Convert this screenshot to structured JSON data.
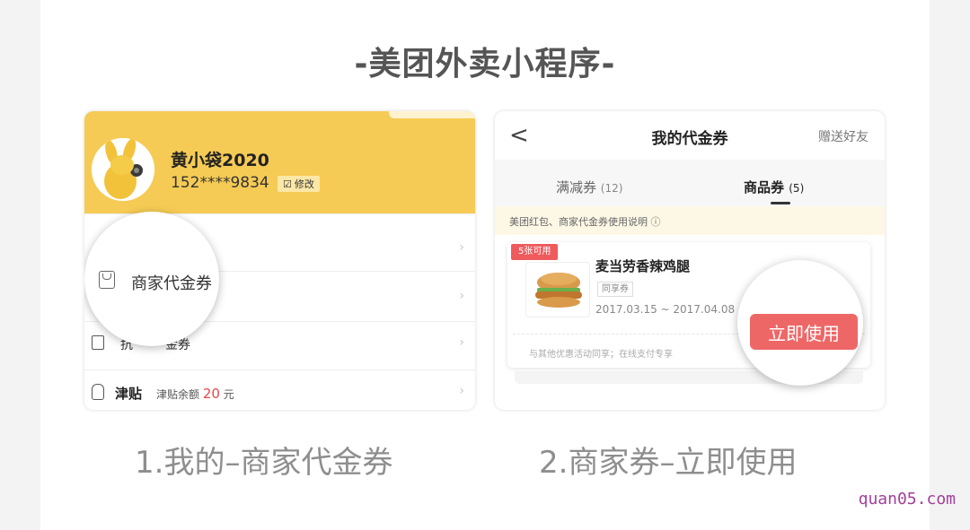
{
  "header": {
    "title": "-美团外卖小程序-"
  },
  "left_panel": {
    "username": "黄小袋2020",
    "phone": "152****9834",
    "edit_label": "修改",
    "magnified_item_label": "商家代金券",
    "partial_row_1": "抗",
    "partial_row_2": "金券",
    "jintie_label": "津贴",
    "jintie_balance_prefix": "津贴余额",
    "jintie_amount": "20",
    "jintie_unit": "元"
  },
  "right_panel": {
    "back_glyph": "<",
    "title": "我的代金券",
    "share_label": "赠送好友",
    "tabs": [
      {
        "label": "满减券",
        "count": "(12)"
      },
      {
        "label": "商品券",
        "count": "(5)"
      }
    ],
    "notice": "美团红包、商家代金券使用说明 ⓘ",
    "coupon": {
      "badge": "5张可用",
      "name": "麦当劳香辣鸡腿",
      "tag": "同享券",
      "date": "2017.03.15 ~ 2017.04.08",
      "rule": "与其他优惠活动同享；在线支付专享",
      "use_button": "立即使用"
    }
  },
  "captions": {
    "step1": "1.我的–商家代金券",
    "step2": "2.商家券–立即使用"
  },
  "watermark": "quan05.com",
  "colors": {
    "profile_bg": "#f6cb55",
    "accent_red": "#ee6767",
    "caption_gray": "#8e8e8e",
    "watermark": "#a33e9a"
  }
}
